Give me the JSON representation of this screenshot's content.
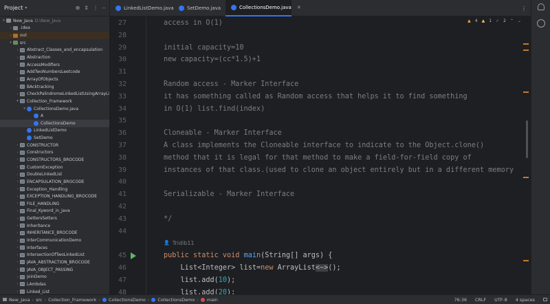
{
  "project": {
    "title": "Project",
    "tree": [
      {
        "indent": 0,
        "arrow": "v",
        "icon": "proj",
        "label": "New_Java",
        "sub": "D:\\New_Java"
      },
      {
        "indent": 1,
        "arrow": ">",
        "icon": "folder",
        "label": ".idea"
      },
      {
        "indent": 1,
        "arrow": ">",
        "icon": "out",
        "label": "out",
        "excluded": true
      },
      {
        "indent": 1,
        "arrow": "v",
        "icon": "src",
        "label": "src"
      },
      {
        "indent": 2,
        "arrow": ">",
        "icon": "pkg",
        "label": "Abstract_Classes_and_encapsulation"
      },
      {
        "indent": 2,
        "arrow": ">",
        "icon": "pkg",
        "label": "Abstraction"
      },
      {
        "indent": 2,
        "arrow": ">",
        "icon": "pkg",
        "label": "AccessModifiers"
      },
      {
        "indent": 2,
        "arrow": ">",
        "icon": "pkg",
        "label": "AddTwoNumbersLeetcode"
      },
      {
        "indent": 2,
        "arrow": ">",
        "icon": "pkg",
        "label": "ArrayOfObjects"
      },
      {
        "indent": 2,
        "arrow": ">",
        "icon": "pkg",
        "label": "BAcktracking"
      },
      {
        "indent": 2,
        "arrow": ">",
        "icon": "pkg",
        "label": "CheckPalindromeLinkedListUsingArrayList"
      },
      {
        "indent": 2,
        "arrow": "v",
        "icon": "pkg",
        "label": "Collection_Framework"
      },
      {
        "indent": 3,
        "arrow": "v",
        "icon": "cls",
        "label": "CollectionsDemo.java"
      },
      {
        "indent": 4,
        "arrow": "",
        "icon": "cls",
        "label": "A"
      },
      {
        "indent": 4,
        "arrow": "",
        "icon": "cls",
        "label": "CollectionsDemo",
        "selected": true
      },
      {
        "indent": 3,
        "arrow": "",
        "icon": "cls",
        "label": "LinkedListDemo"
      },
      {
        "indent": 3,
        "arrow": "",
        "icon": "cls",
        "label": "SetDemo"
      },
      {
        "indent": 2,
        "arrow": ">",
        "icon": "pkg",
        "label": "CONSTRUCTOR"
      },
      {
        "indent": 2,
        "arrow": ">",
        "icon": "pkg",
        "label": "Constructors"
      },
      {
        "indent": 2,
        "arrow": ">",
        "icon": "pkg",
        "label": "CONSTRUCTORS_BROCODE"
      },
      {
        "indent": 2,
        "arrow": ">",
        "icon": "pkg",
        "label": "CustomException"
      },
      {
        "indent": 2,
        "arrow": ">",
        "icon": "pkg",
        "label": "DoubleLinkedList"
      },
      {
        "indent": 2,
        "arrow": ">",
        "icon": "pkg",
        "label": "ENCAPSULATION_BROCODE"
      },
      {
        "indent": 2,
        "arrow": ">",
        "icon": "pkg",
        "label": "Exception_Handling"
      },
      {
        "indent": 2,
        "arrow": ">",
        "icon": "pkg",
        "label": "EXCEPTION_HANDLING_BROCODE"
      },
      {
        "indent": 2,
        "arrow": ">",
        "icon": "pkg",
        "label": "FILE_HANDLING"
      },
      {
        "indent": 2,
        "arrow": ">",
        "icon": "pkg",
        "label": "Final_Kyword_in_java"
      },
      {
        "indent": 2,
        "arrow": ">",
        "icon": "pkg",
        "label": "GettersSetters"
      },
      {
        "indent": 2,
        "arrow": ">",
        "icon": "pkg",
        "label": "Inheritance"
      },
      {
        "indent": 2,
        "arrow": ">",
        "icon": "pkg",
        "label": "INHERITANCE_BROCODE"
      },
      {
        "indent": 2,
        "arrow": ">",
        "icon": "pkg",
        "label": "InterCommunicationDemo"
      },
      {
        "indent": 2,
        "arrow": ">",
        "icon": "pkg",
        "label": "Interfaces"
      },
      {
        "indent": 2,
        "arrow": ">",
        "icon": "pkg",
        "label": "IntersectionOfTwoLinkedList"
      },
      {
        "indent": 2,
        "arrow": ">",
        "icon": "pkg",
        "label": "JAVA_ABSTRACTION_BROCODE"
      },
      {
        "indent": 2,
        "arrow": ">",
        "icon": "pkg",
        "label": "JAVA_OBJECT_PASSING"
      },
      {
        "indent": 2,
        "arrow": ">",
        "icon": "pkg",
        "label": "JoinDemo"
      },
      {
        "indent": 2,
        "arrow": ">",
        "icon": "pkg",
        "label": "LAmbdas"
      },
      {
        "indent": 2,
        "arrow": ">",
        "icon": "pkg",
        "label": "Linked_List"
      }
    ]
  },
  "tabs": [
    {
      "label": "LinkedListDemo.java",
      "active": false
    },
    {
      "label": "SetDemo.java",
      "active": false
    },
    {
      "label": "CollectionsDemo.java",
      "active": true
    }
  ],
  "inspections": {
    "warnings": "4",
    "weak": "1",
    "ok": "2"
  },
  "editor": {
    "line_numbers": [
      "27",
      "28",
      "29",
      "30",
      "31",
      "32",
      "33",
      "34",
      "35",
      "36",
      "37",
      "38",
      "39",
      "40",
      "41",
      "42",
      "43",
      "44",
      "",
      "45",
      "46",
      "47",
      "48"
    ],
    "lines": [
      {
        "t": "c",
        "text": "access in O(1)"
      },
      {
        "t": "c",
        "text": ""
      },
      {
        "t": "c",
        "text": "initial capacity=10"
      },
      {
        "t": "c",
        "text": "new capacity=(cc*1.5)+1"
      },
      {
        "t": "c",
        "text": ""
      },
      {
        "t": "c",
        "text": "Random access - Marker Interface"
      },
      {
        "t": "c",
        "text": "it has something called as Random access that helps it to find something"
      },
      {
        "t": "c",
        "text": "in O(1) list.find(index)"
      },
      {
        "t": "c",
        "text": ""
      },
      {
        "t": "c",
        "text": "Cloneable - Marker Interface"
      },
      {
        "t": "c",
        "text": "A class implements the Cloneable interface to indicate to the Object.clone()"
      },
      {
        "t": "c",
        "text": "method that it is legal for that method to make a field-for-field copy of"
      },
      {
        "t": "c",
        "text": "instances of that class.(used to clone an object entirely but in a different memory"
      },
      {
        "t": "c",
        "text": ""
      },
      {
        "t": "c",
        "text": "Serializable - Marker Interface"
      },
      {
        "t": "c",
        "text": ""
      },
      {
        "t": "c",
        "text": "*/"
      },
      {
        "t": "c",
        "text": ""
      },
      {
        "t": "author",
        "text": "Tridib11"
      }
    ],
    "code_main": {
      "kw1": "public",
      "kw2": "static",
      "kw3": "void",
      "fn": "main",
      "p1": "(",
      "ty": "String",
      "p2": "[] args) {"
    },
    "code_list": {
      "t1": "List<",
      "t2": "Integer",
      "t3": "> list=",
      "kw": "new",
      "t4": " ArrayList",
      "t5": "<~>",
      "t6": "();"
    },
    "code_add1": {
      "a": "list.add(",
      "n": "10",
      "b": ");"
    },
    "code_add2": {
      "a": "list.add(",
      "n": "20",
      "b": ");"
    }
  },
  "status": {
    "crumbs": [
      "New_Java",
      "src",
      "Collection_Framework",
      "CollectionsDemo",
      "CollectionsDemo",
      "main"
    ],
    "position": "76:36",
    "line_sep": "CRLF",
    "encoding": "UTF-8",
    "indent": "4 spaces"
  }
}
